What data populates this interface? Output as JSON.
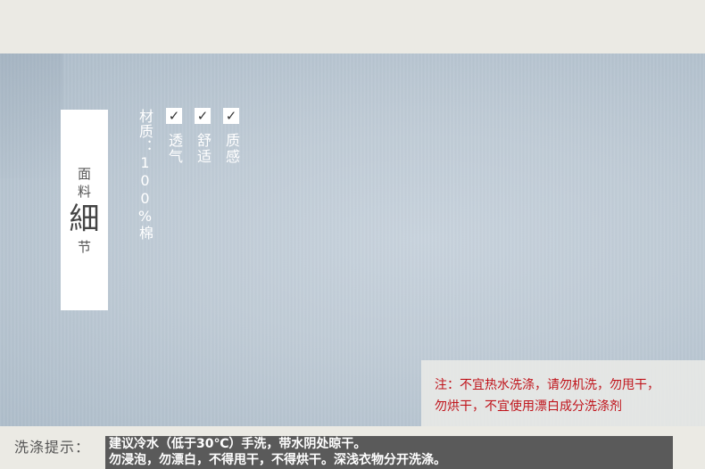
{
  "detail_card": {
    "line1": "面",
    "line2": "料",
    "big": "細",
    "line4": "节"
  },
  "material": "材质：100%棉",
  "features": [
    {
      "check": "✓",
      "label": "透气"
    },
    {
      "check": "✓",
      "label": "舒适"
    },
    {
      "check": "✓",
      "label": "质感"
    }
  ],
  "warning": {
    "line1": "注：不宜热水洗涤，请勿机洗，勿甩干，",
    "line2": "勿烘干，不宜使用漂白成分洗涤剂"
  },
  "wash": {
    "label": "洗涤提示：",
    "line1": "建议冷水（低于30℃）手洗，带水阴处晾干。",
    "line2": "勿浸泡，勿漂白，不得甩干，不得烘干。深浅衣物分开洗涤。"
  },
  "colors": {
    "warning_text": "#c0141b",
    "wash_box": "#5a5a5a",
    "fabric": "#bfcbd6"
  }
}
